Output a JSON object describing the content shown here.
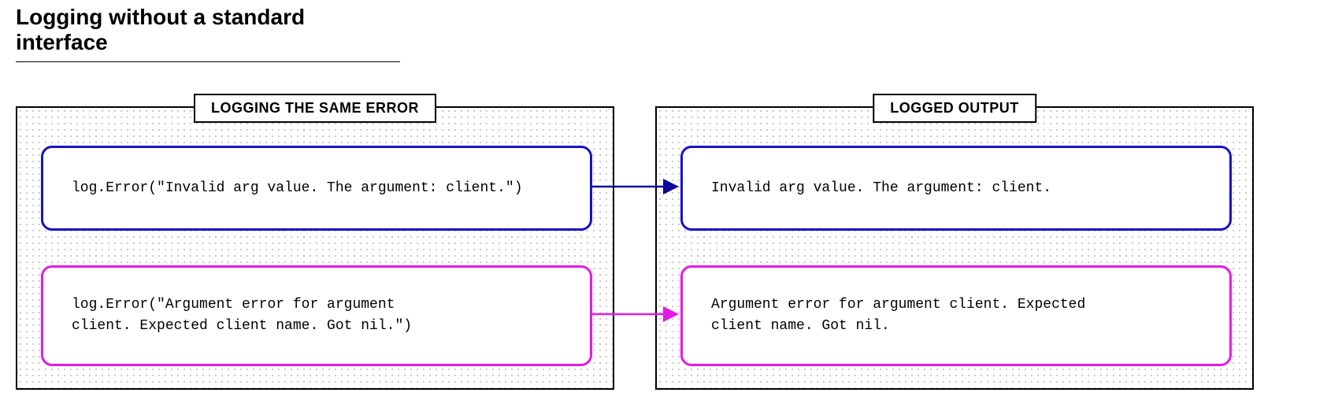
{
  "title": "Logging without a standard interface",
  "panels": {
    "left": {
      "label": "LOGGING THE SAME ERROR"
    },
    "right": {
      "label": "LOGGED OUTPUT"
    }
  },
  "pairs": [
    {
      "color": "blue",
      "arrow_color": "#0a0aa0",
      "input": "log.Error(\"Invalid arg value. The argument: client.\")",
      "output": "Invalid arg value. The argument: client."
    },
    {
      "color": "magenta",
      "arrow_color": "#e619e6",
      "input": "log.Error(\"Argument error for argument\nclient. Expected client name. Got nil.\")",
      "output": "Argument error for argument client. Expected\nclient name. Got nil."
    }
  ]
}
